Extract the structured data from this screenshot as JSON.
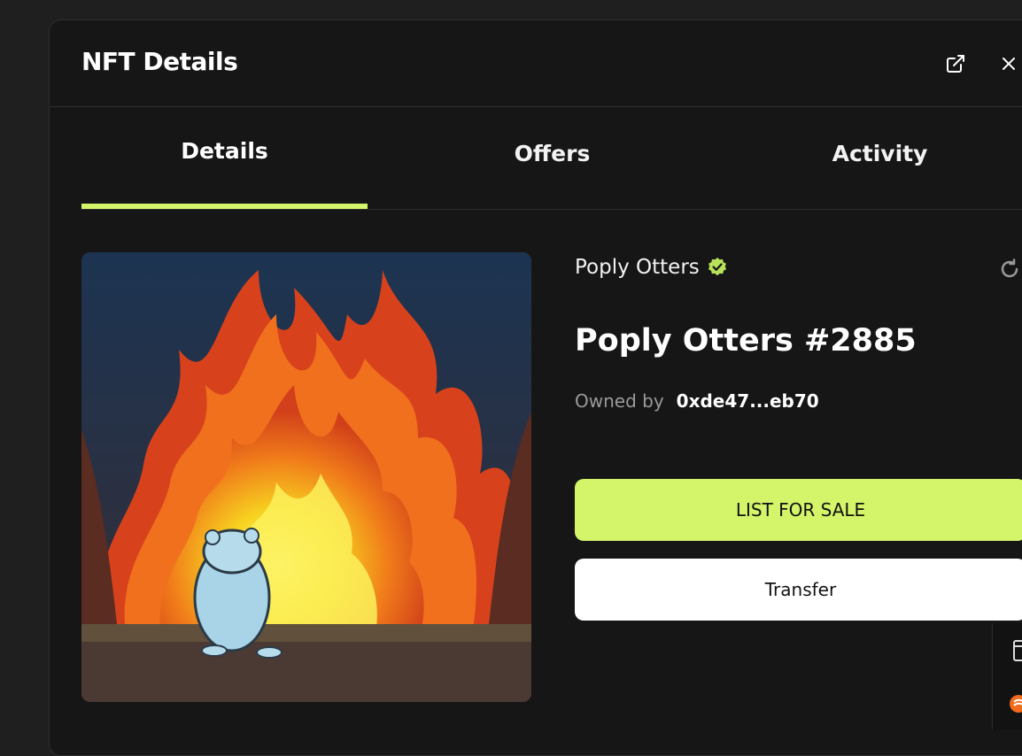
{
  "modal": {
    "title": "NFT Details",
    "open_external_icon": "external-link-icon",
    "close_icon": "close-icon"
  },
  "tabs": [
    {
      "label": "Details",
      "active": true
    },
    {
      "label": "Offers",
      "active": false
    },
    {
      "label": "Activity",
      "active": false
    }
  ],
  "nft": {
    "collection": "Poply Otters",
    "verified": true,
    "name": "Poply Otters #2885",
    "owned_by_label": "Owned by",
    "owner": "0xde47...eb70"
  },
  "actions": {
    "list_label": "LIST FOR SALE",
    "transfer_label": "Transfer"
  },
  "colors": {
    "accent": "#d4f56a",
    "background": "#161616"
  }
}
